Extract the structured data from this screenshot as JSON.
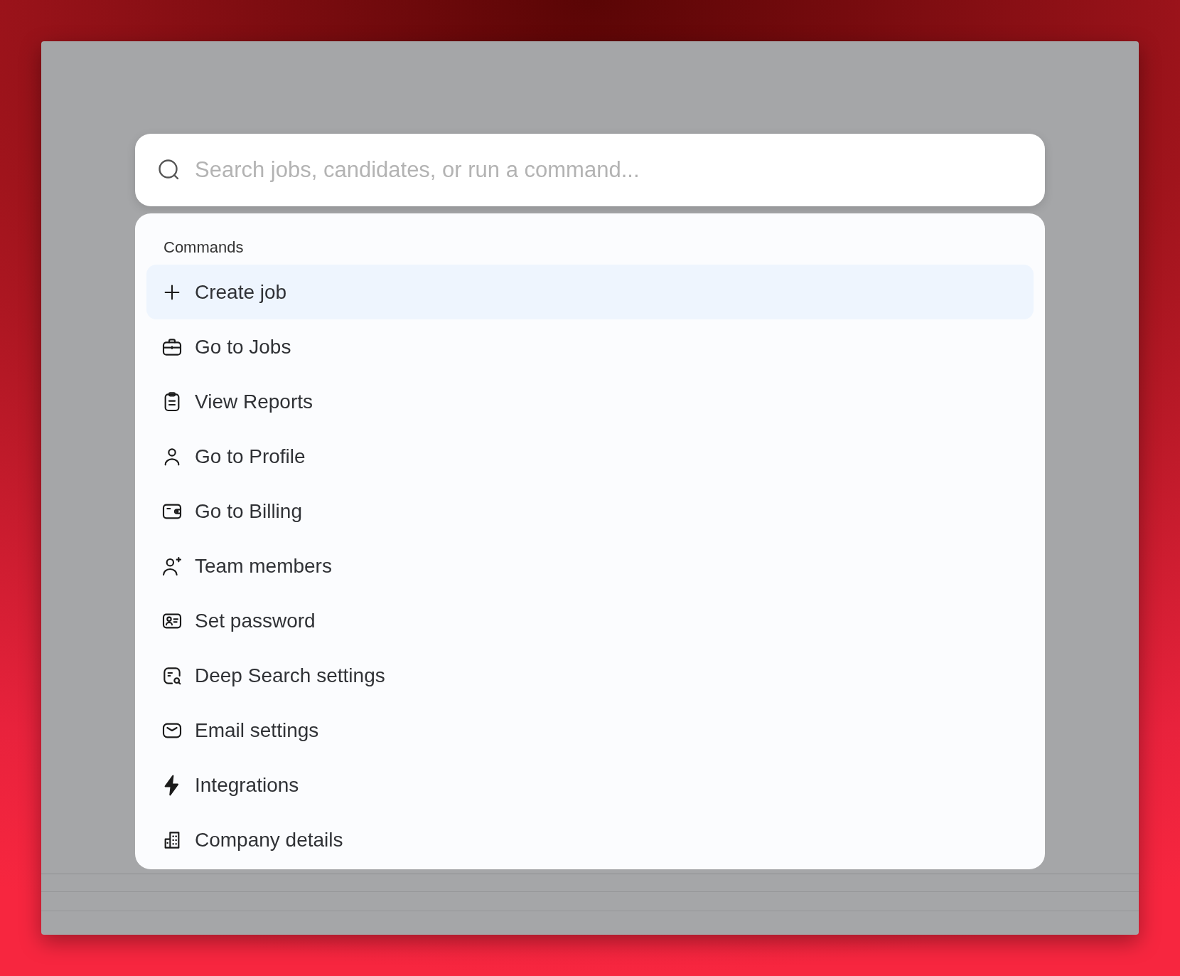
{
  "search": {
    "placeholder": "Search jobs, candidates, or run a command..."
  },
  "commands": {
    "heading": "Commands",
    "items": [
      {
        "label": "Create job",
        "kind": "plus",
        "selected": true
      },
      {
        "label": "Go to Jobs",
        "kind": "briefcase",
        "selected": false
      },
      {
        "label": "View Reports",
        "kind": "clipboard",
        "selected": false
      },
      {
        "label": "Go to Profile",
        "kind": "person",
        "selected": false
      },
      {
        "label": "Go to Billing",
        "kind": "wallet",
        "selected": false
      },
      {
        "label": "Team members",
        "kind": "person-plus",
        "selected": false
      },
      {
        "label": "Set password",
        "kind": "id-card",
        "selected": false
      },
      {
        "label": "Deep Search settings",
        "kind": "document-search",
        "selected": false
      },
      {
        "label": "Email settings",
        "kind": "envelope",
        "selected": false
      },
      {
        "label": "Integrations",
        "kind": "lightning",
        "selected": false
      },
      {
        "label": "Company details",
        "kind": "building",
        "selected": false
      }
    ]
  }
}
